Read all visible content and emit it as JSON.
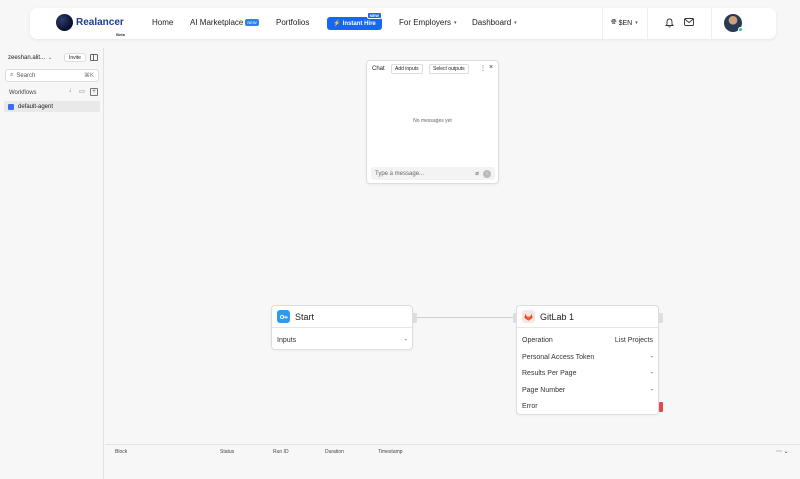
{
  "brand": {
    "name": "Realancer",
    "beta": "Beta"
  },
  "nav": {
    "home": "Home",
    "ai_marketplace": "AI Marketplace",
    "ai_marketplace_badge": "NEW",
    "portfolios": "Portfolios",
    "instant_hire": "Instant Hire",
    "instant_hire_badge": "NEW",
    "for_employers": "For Employers",
    "dashboard": "Dashboard",
    "language": "$EN"
  },
  "sidebar": {
    "workspace": "zeeshan.alit...",
    "invite": "Invite",
    "search_placeholder": "Search",
    "search_shortcut": "⌘K",
    "workflows_label": "Workflows",
    "workflows": [
      {
        "label": "default-agent"
      }
    ]
  },
  "chat": {
    "title": "Chat",
    "add_inputs": "Add inputs",
    "select_outputs": "Select outputs",
    "empty": "No messages yet",
    "input_placeholder": "Type a message..."
  },
  "nodes": {
    "start": {
      "title": "Start",
      "rows": [
        {
          "label": "Inputs",
          "value": "-"
        }
      ]
    },
    "gitlab": {
      "title": "GitLab 1",
      "rows": [
        {
          "label": "Operation",
          "value": "List Projects"
        },
        {
          "label": "Personal Access Token",
          "value": "-"
        },
        {
          "label": "Results Per Page",
          "value": "-"
        },
        {
          "label": "Page Number",
          "value": "-"
        },
        {
          "label": "Error",
          "value": ""
        }
      ]
    }
  },
  "logs": {
    "columns": [
      "Block",
      "Status",
      "Run ID",
      "Duration",
      "Timestamp"
    ],
    "more": "⋯ ⌄"
  },
  "colors": {
    "accent": "#1667f2",
    "start_icon": "#2d9cf0",
    "error": "#e5484d",
    "brand_text": "#1d3c8f"
  }
}
